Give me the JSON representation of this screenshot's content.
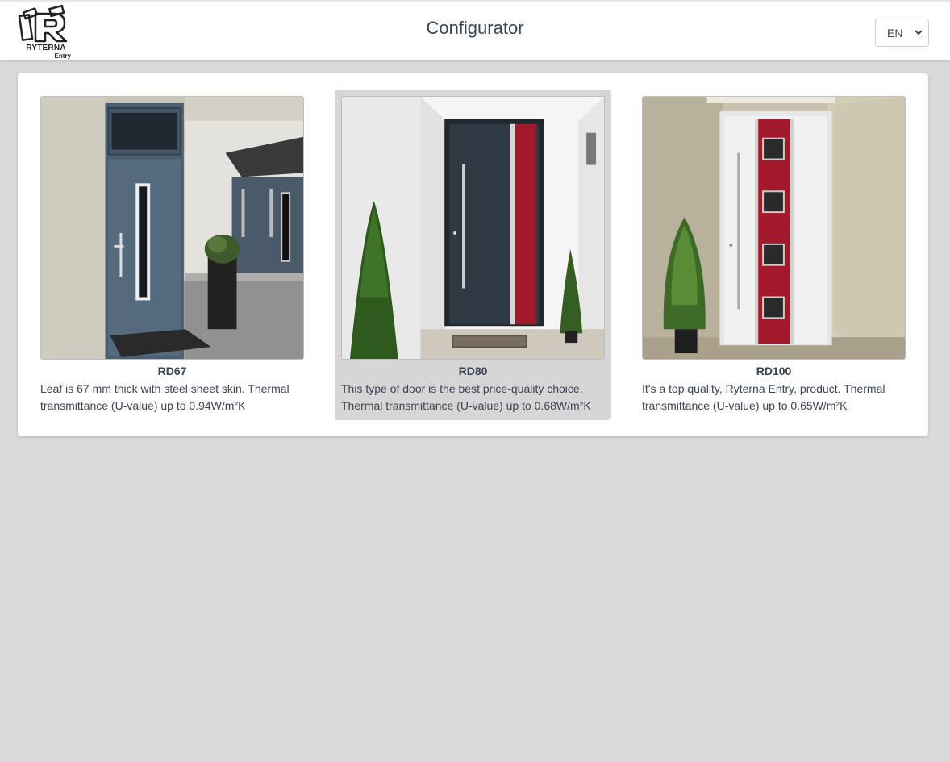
{
  "header": {
    "logo": {
      "name": "RYTERNA",
      "sub": "Entry"
    },
    "title": "Configurator",
    "language": {
      "selected": "EN",
      "options": [
        "EN"
      ]
    }
  },
  "products": [
    {
      "name": "RD67",
      "description": "Leaf is 67 mm thick with steel sheet skin. Thermal transmittance (U-value) up to 0.94W/m²K",
      "selected": false,
      "door_color": "#3f5468"
    },
    {
      "name": "RD80",
      "description": "This type of door is the best price-quality choice. Thermal transmittance (U-value) up to 0.68W/m²K",
      "selected": true,
      "door_color": "#2b3540"
    },
    {
      "name": "RD100",
      "description": "It's a top quality, Ryterna Entry, product. Thermal transmittance (U-value) up to 0.65W/m²K",
      "selected": false,
      "door_color": "#e8e8e8"
    }
  ],
  "colors": {
    "accent_red": "#a3192c",
    "background": "#d9d9d9",
    "text": "#3a4556"
  }
}
